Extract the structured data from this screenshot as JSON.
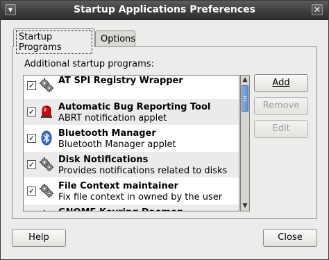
{
  "window": {
    "title": "Startup Applications Preferences"
  },
  "tabs": [
    {
      "label": "Startup Programs",
      "active": true
    },
    {
      "label": "Options",
      "active": false
    }
  ],
  "panel": {
    "label": "Additional startup programs:"
  },
  "programs": [
    {
      "name": "AT SPI Registry Wrapper",
      "desc": "",
      "checked": true,
      "icon": "gears-icon"
    },
    {
      "name": "Automatic Bug Reporting Tool",
      "desc": "ABRT notification applet",
      "checked": true,
      "icon": "red-alarm-icon"
    },
    {
      "name": "Bluetooth Manager",
      "desc": "Bluetooth Manager applet",
      "checked": true,
      "icon": "bluetooth-icon"
    },
    {
      "name": "Disk Notifications",
      "desc": "Provides notifications related to disks",
      "checked": true,
      "icon": "gears-icon"
    },
    {
      "name": "File Context maintainer",
      "desc": "Fix file context in owned by the user",
      "checked": true,
      "icon": "gears-icon"
    },
    {
      "name": "GNOME Keyring Daemon",
      "desc": "",
      "checked": true,
      "icon": "gears-icon"
    }
  ],
  "buttons": {
    "add": "Add",
    "remove": "Remove",
    "edit": "Edit",
    "help": "Help",
    "close": "Close"
  },
  "scrollbar": {
    "position_fraction": 0.0
  },
  "colors": {
    "titlebar": "#3c3c3c",
    "scroll_thumb": "#6f9ad6",
    "alarm": "#d40000",
    "bluetooth": "#3b6fc4"
  }
}
